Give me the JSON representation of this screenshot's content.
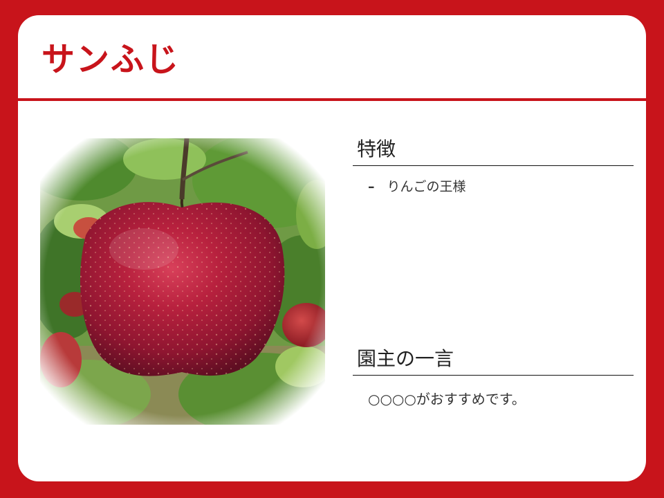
{
  "slide": {
    "title": "サンふじ",
    "features": {
      "heading": "特徴",
      "items": [
        {
          "marker": "–",
          "text": "りんごの王様"
        }
      ]
    },
    "comment": {
      "heading": "園主の一言",
      "text": "○○○○がおすすめです。"
    },
    "photo_subject": "red-apple-on-tree",
    "colors": {
      "accent": "#c8141b",
      "background": "#ffffff",
      "text": "#333333"
    }
  }
}
